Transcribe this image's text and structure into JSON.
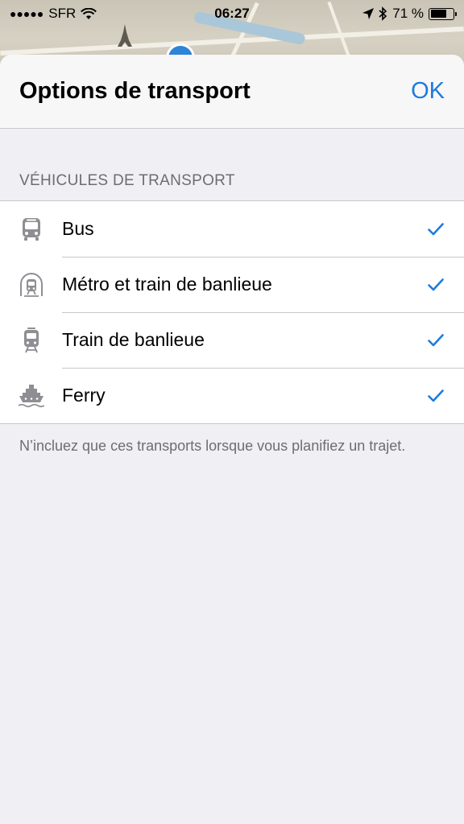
{
  "status_bar": {
    "signal": "●●●●●",
    "carrier": "SFR",
    "time": "06:27",
    "battery_percent": "71 %",
    "battery_level": 0.71
  },
  "sheet": {
    "title": "Options de transport",
    "done_label": "OK",
    "section_header": "VÉHICULES DE TRANSPORT",
    "items": [
      {
        "label": "Bus",
        "icon": "bus-icon",
        "checked": true
      },
      {
        "label": "Métro et train de banlieue",
        "icon": "metro-icon",
        "checked": true
      },
      {
        "label": "Train de banlieue",
        "icon": "train-icon",
        "checked": true
      },
      {
        "label": "Ferry",
        "icon": "ferry-icon",
        "checked": true
      }
    ],
    "footer": "N’incluez que ces transports lorsque vous planifiez un trajet."
  },
  "colors": {
    "accent": "#1f7ae0",
    "background": "#efeff4",
    "secondary_text": "#6d6d72",
    "icon_gray": "#8e8e93"
  }
}
